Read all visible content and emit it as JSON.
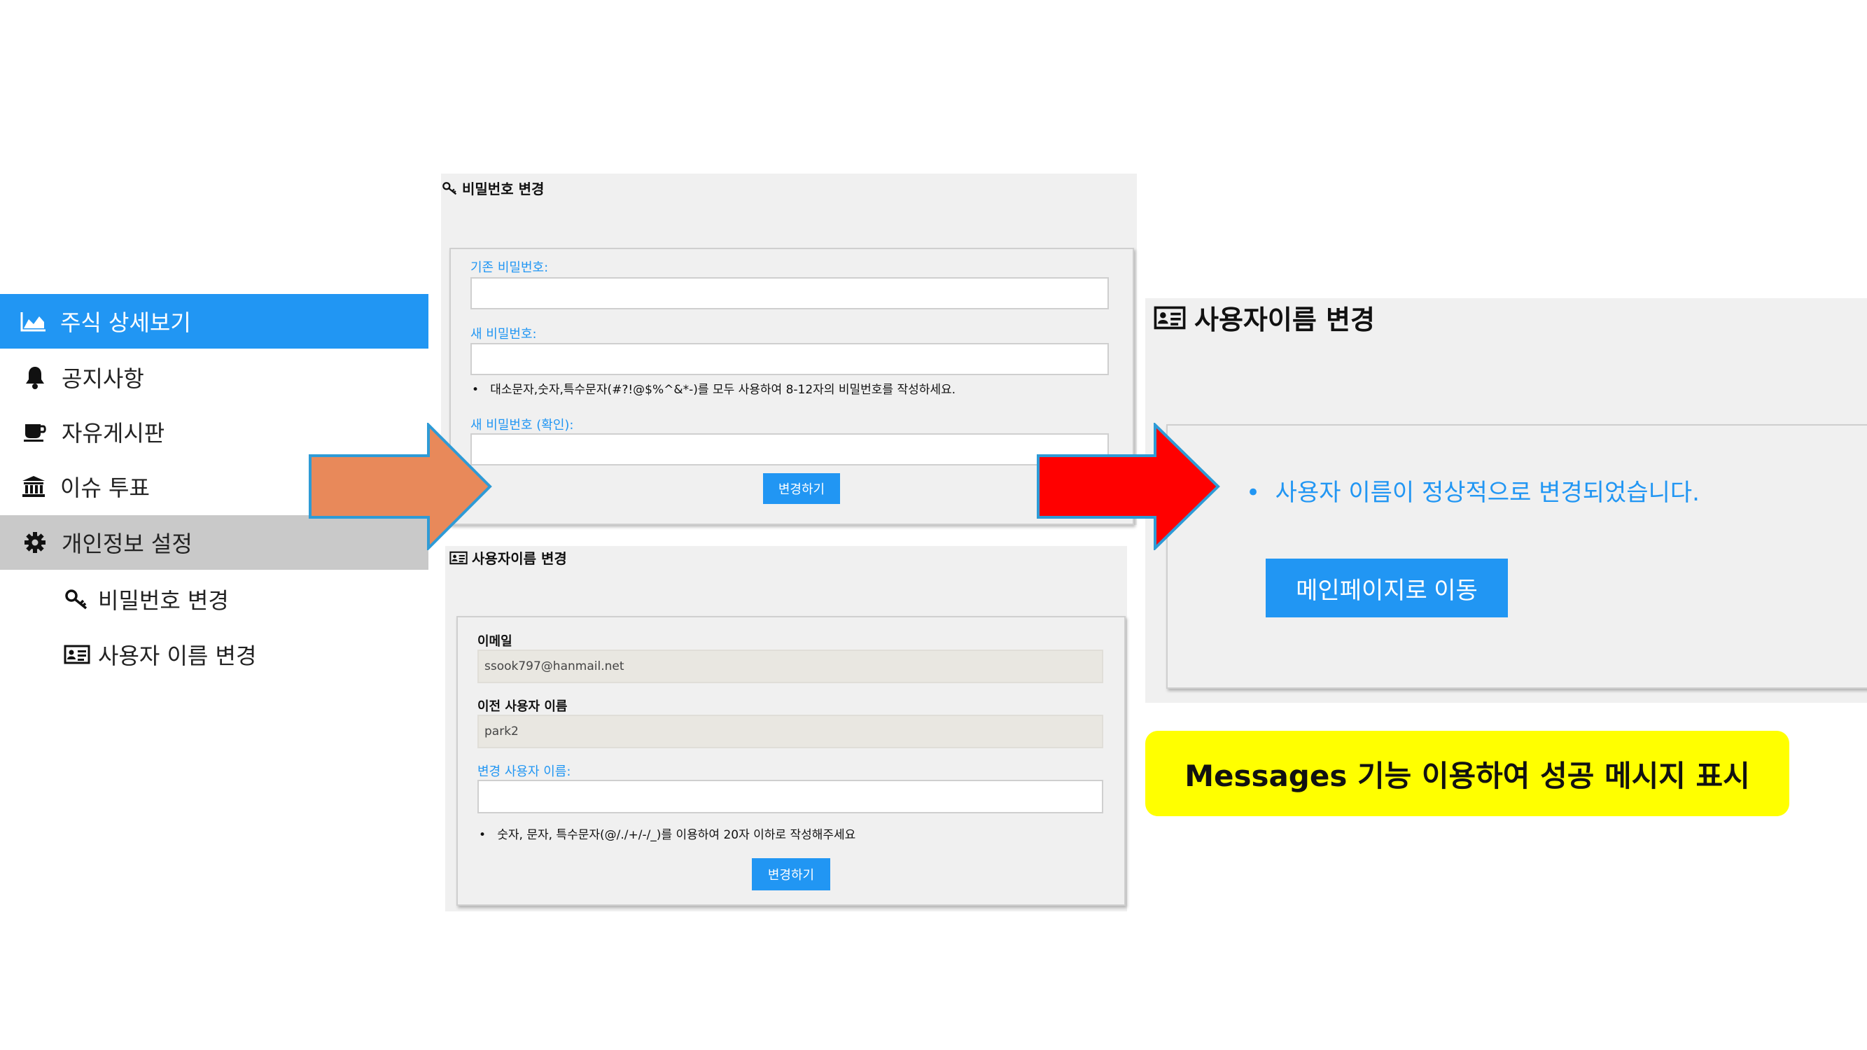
{
  "sidebar": {
    "items": [
      {
        "label": "주식 상세보기",
        "icon": "area-chart-icon"
      },
      {
        "label": "공지사항",
        "icon": "bell-icon"
      },
      {
        "label": "자유게시판",
        "icon": "coffee-icon"
      },
      {
        "label": "이슈 투표",
        "icon": "bank-icon"
      },
      {
        "label": "개인정보 설정",
        "icon": "gear-icon"
      }
    ],
    "subitems": [
      {
        "label": "비밀번호 변경",
        "icon": "key-icon"
      },
      {
        "label": "사용자 이름 변경",
        "icon": "id-card-icon"
      }
    ]
  },
  "password_panel": {
    "title": "비밀번호 변경",
    "current_label": "기존 비밀번호:",
    "new_label": "새 비밀번호:",
    "hint": "대소문자,숫자,특수문자(#?!@$%^&*-)를 모두 사용하여 8-12자의 비밀번호를 작성하세요.",
    "confirm_label": "새 비밀번호 (확인):",
    "submit": "변경하기"
  },
  "username_panel": {
    "title": "사용자이름 변경",
    "email_label": "이메일",
    "email_value": "ssook797@hanmail.net",
    "prev_label": "이전 사용자 이름",
    "prev_value": "park2",
    "new_label": "변경 사용자 이름:",
    "hint": "숫자, 문자, 특수문자(@/./+/-/_)를 이용하여 20자 이하로 작성해주세요",
    "submit": "변경하기"
  },
  "result_panel": {
    "title": "사용자이름 변경",
    "message": "사용자 이름이 정상적으로 변경되었습니다.",
    "button": "메인페이지로 이동"
  },
  "callout": {
    "text": "Messages 기능 이용하여 성공 메시지 표시"
  },
  "colors": {
    "accent": "#2196f3",
    "settings_bg": "#c9c9c9",
    "panel_bg": "#f0f0f0",
    "arrow_orange": "#e8895a",
    "arrow_red": "#ff0000",
    "callout_bg": "#ffff00"
  }
}
